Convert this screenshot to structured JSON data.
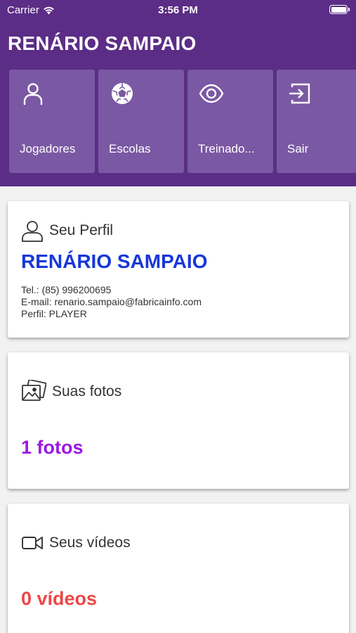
{
  "status_bar": {
    "carrier": "Carrier",
    "time": "3:56 PM"
  },
  "header": {
    "title": "RENÁRIO SAMPAIO"
  },
  "menu": {
    "items": [
      {
        "label": "Jogadores",
        "icon": "person-icon"
      },
      {
        "label": "Escolas",
        "icon": "soccer-ball-icon"
      },
      {
        "label": "Treinado...",
        "icon": "eye-icon"
      },
      {
        "label": "Sair",
        "icon": "sign-out-icon"
      }
    ]
  },
  "profile_card": {
    "heading": "Seu Perfil",
    "name": "RENÁRIO SAMPAIO",
    "phone": "Tel.: (85) 996200695",
    "email": "E-mail: renario.sampaio@fabricainfo.com",
    "role": "Perfil: PLAYER"
  },
  "photos_card": {
    "heading": "Suas fotos",
    "count": "1 fotos"
  },
  "videos_card": {
    "heading": "Seus vídeos",
    "count": "0 vídeos"
  },
  "colors": {
    "header_bg": "#5b2d86",
    "tile_bg": "#7a58a3",
    "name_blue": "#1737d9",
    "photos_purple": "#9b19e0",
    "videos_red": "#ec4747"
  }
}
